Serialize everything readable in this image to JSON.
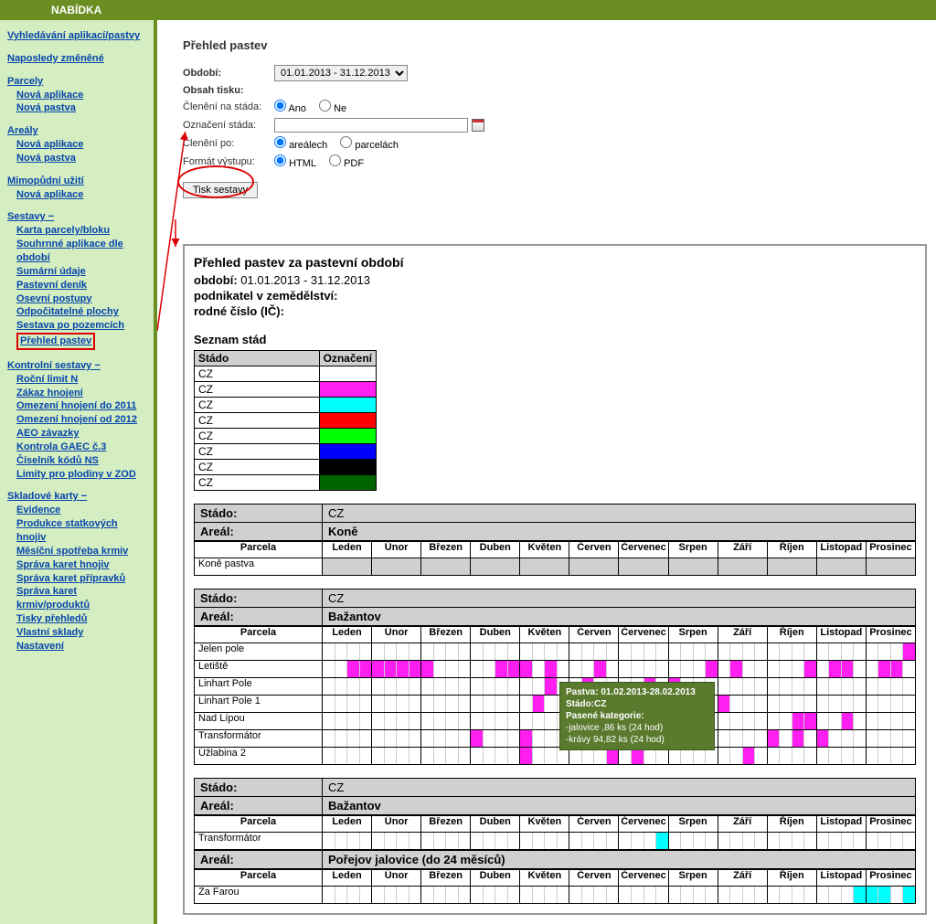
{
  "topbar": "NABÍDKA",
  "sidebar": {
    "s1": "Vyhledávání aplikací/pastvy",
    "s2": "Naposledy změněné",
    "g1": {
      "h": "Parcely",
      "a": "Nová aplikace",
      "b": "Nová pastva"
    },
    "g2": {
      "h": "Areály",
      "a": "Nová aplikace",
      "b": "Nová pastva"
    },
    "g3": {
      "h": "Mimopůdní užití",
      "a": "Nová aplikace"
    },
    "g4": {
      "h": "Sestavy −",
      "items": [
        "Karta parcely/bloku",
        "Souhrnné aplikace dle období",
        "Sumární údaje",
        "Pastevní deník",
        "Osevní postupy",
        "Odpočitatelné plochy",
        "Sestava po pozemcích",
        "Přehled pastev"
      ]
    },
    "g5": {
      "h": "Kontrolní sestavy −",
      "items": [
        "Roční limit N",
        "Zákaz hnojení",
        "Omezení hnojení do 2011",
        "Omezení hnojení od 2012",
        "AEO závazky",
        "Kontrola GAEC č.3",
        "Číselník kódů NS",
        "Limity pro plodiny v ZOD"
      ]
    },
    "g6": {
      "h": "Skladové karty −",
      "items": [
        "Evidence",
        "Produkce statkových hnojiv",
        "Měsíční spotřeba krmiv",
        "Správa karet hnojiv",
        "Správa karet přípravků",
        "Správa karet krmiv/produktů",
        "Tisky přehledů",
        "Vlastní sklady",
        "Nastavení"
      ]
    }
  },
  "form": {
    "title": "Přehled pastev",
    "obdobi_lbl": "Období:",
    "obdobi_val": "01.01.2013 - 31.12.2013",
    "obsah": "Obsah tisku:",
    "cleneni_stada": "Členění na stáda:",
    "ano": "Ano",
    "ne": "Ne",
    "oznaceni": "Označení stáda:",
    "cleneni_po": "Členění po:",
    "arealech": "areálech",
    "parcelach": "parcelách",
    "format": "Formát výstupu:",
    "html": "HTML",
    "pdf": "PDF",
    "btn": "Tisk sestavy"
  },
  "report": {
    "title": "Přehled pastev za pastevní období",
    "obdobi_lbl": "období:",
    "obdobi_val": "01.01.2013 - 31.12.2013",
    "podnik": "podnikatel v zemědělství:",
    "rc": "rodné číslo (IČ):",
    "seznam": "Seznam stád",
    "th_stado": "Stádo",
    "th_ozn": "Označení",
    "herds": [
      {
        "n": "CZ",
        "c": "#ffffff"
      },
      {
        "n": "CZ",
        "c": "#ff1ff0"
      },
      {
        "n": "CZ",
        "c": "#00ffff"
      },
      {
        "n": "CZ",
        "c": "#ff0000"
      },
      {
        "n": "CZ",
        "c": "#00ff00"
      },
      {
        "n": "CZ",
        "c": "#0000ff"
      },
      {
        "n": "CZ",
        "c": "#000000"
      },
      {
        "n": "CZ",
        "c": "#006400"
      }
    ],
    "lbl_stado": "Stádo:",
    "lbl_areal": "Areál:",
    "months": [
      "Leden",
      "Únor",
      "Březen",
      "Duben",
      "Květen",
      "Červen",
      "Červenec",
      "Srpen",
      "Září",
      "Říjen",
      "Listopad",
      "Prosinec"
    ],
    "parcela": "Parcela",
    "b1": {
      "stado": "CZ",
      "areal": "Koně",
      "rows": [
        "Koně pastva"
      ]
    },
    "b2": {
      "stado": "CZ",
      "areal": "Bažantov",
      "rows": [
        "Jelen pole",
        "Letiště",
        "Linhart Pole",
        "Linhart Pole 1",
        "Nad Lípou",
        "Transformátor",
        "Úžlabina 2"
      ]
    },
    "b3": {
      "stado": "CZ",
      "areal1": "Bažantov",
      "rows1": [
        "Transformátor"
      ],
      "areal2": "Pořejov jalovice (do 24 měsíců)",
      "rows2": [
        "Za Farou"
      ]
    }
  },
  "tooltip": {
    "l1": "Pastva: 01.02.2013-28.02.2013",
    "l2": "Stádo:CZ",
    "l3": "Pasené kategorie:",
    "l4": "-jalovice ,86 ks (24 hod)",
    "l5": "-krávy 94,82 ks (24 hod)"
  }
}
